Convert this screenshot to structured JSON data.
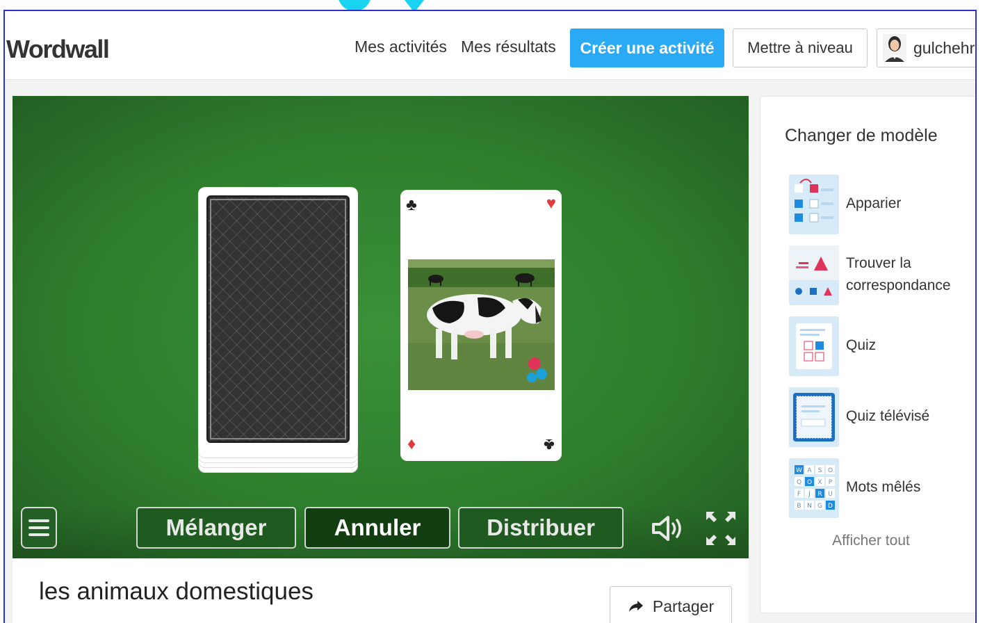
{
  "header": {
    "logo": "Wordwall",
    "nav": [
      "Mes activités",
      "Mes résultats"
    ],
    "create_label": "Créer une activité",
    "upgrade_label": "Mettre à niveau",
    "username": "gulchehra"
  },
  "game": {
    "buttons": [
      "Mélanger",
      "Annuler",
      "Distribuer"
    ],
    "icons": [
      "menu-icon",
      "speaker-icon",
      "fullscreen-icon"
    ],
    "card_suits": [
      "club",
      "heart"
    ]
  },
  "activity": {
    "title": "les animaux domestiques",
    "share_label": "Partager"
  },
  "sidebar": {
    "title": "Changer de modèle",
    "templates": [
      {
        "label": "Apparier"
      },
      {
        "label_line1": "Trouver la",
        "label_line2": "correspondance"
      },
      {
        "label": "Quiz"
      },
      {
        "label": "Quiz télévisé"
      },
      {
        "label": "Mots mêlés"
      }
    ],
    "show_all": "Afficher tout"
  },
  "colors": {
    "accent": "#2aaaf4",
    "felt": "#2e7d2f",
    "frame_border": "#2b2fd6"
  }
}
